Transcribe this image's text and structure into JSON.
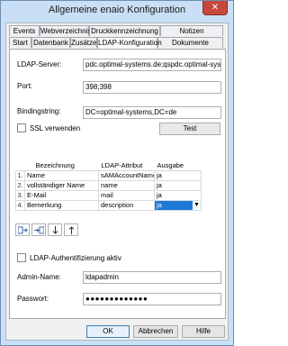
{
  "window": {
    "title": "Allgemeine enaio  Konfiguration",
    "close_glyph": "✕"
  },
  "tabs_row1": [
    "Events",
    "Webverzeichnis",
    "Druckkennzeichnung",
    "Notizen"
  ],
  "tabs_row2": [
    "Start",
    "Datenbank",
    "Zusätze",
    "LDAP-Konfiguration",
    "Dokumente"
  ],
  "ldap": {
    "server_label": "LDAP-Server:",
    "server_value": "pdc.optimal-systems.de;qspdc.optimal-syste",
    "port_label": "Port:",
    "port_value": "398;398",
    "bind_label": "Bindingstring:",
    "bind_value": "DC=optimal-systems,DC=de",
    "ssl_label": "SSL verwenden",
    "ssl_checked": false,
    "test_label": "Test"
  },
  "mapping_table": {
    "columns": [
      "Bezeichnung",
      "LDAP-Attribut",
      "Ausgabe"
    ],
    "rows": [
      {
        "num": "1.",
        "bezeichnung": "Name",
        "attribut": "sAMAccountName",
        "ausgabe": "ja"
      },
      {
        "num": "2.",
        "bezeichnung": "vollständiger Name",
        "attribut": "name",
        "ausgabe": "ja"
      },
      {
        "num": "3.",
        "bezeichnung": "E-Mail",
        "attribut": "mail",
        "ausgabe": "ja"
      },
      {
        "num": "4.",
        "bezeichnung": "Bemerkung",
        "attribut": "description",
        "ausgabe": "ja"
      }
    ]
  },
  "toolbar_icons": [
    "insert-row-icon",
    "delete-row-icon",
    "move-down-icon",
    "move-up-icon"
  ],
  "auth": {
    "label": "LDAP-Authentifizierung aktiv",
    "checked": false,
    "admin_label": "Admin-Name:",
    "admin_value": "ldapadmin",
    "password_label": "Passwort:",
    "password_value": "●●●●●●●●●●●●●"
  },
  "footer": {
    "ok": "OK",
    "cancel": "Abbrechen",
    "help": "Hilfe"
  }
}
